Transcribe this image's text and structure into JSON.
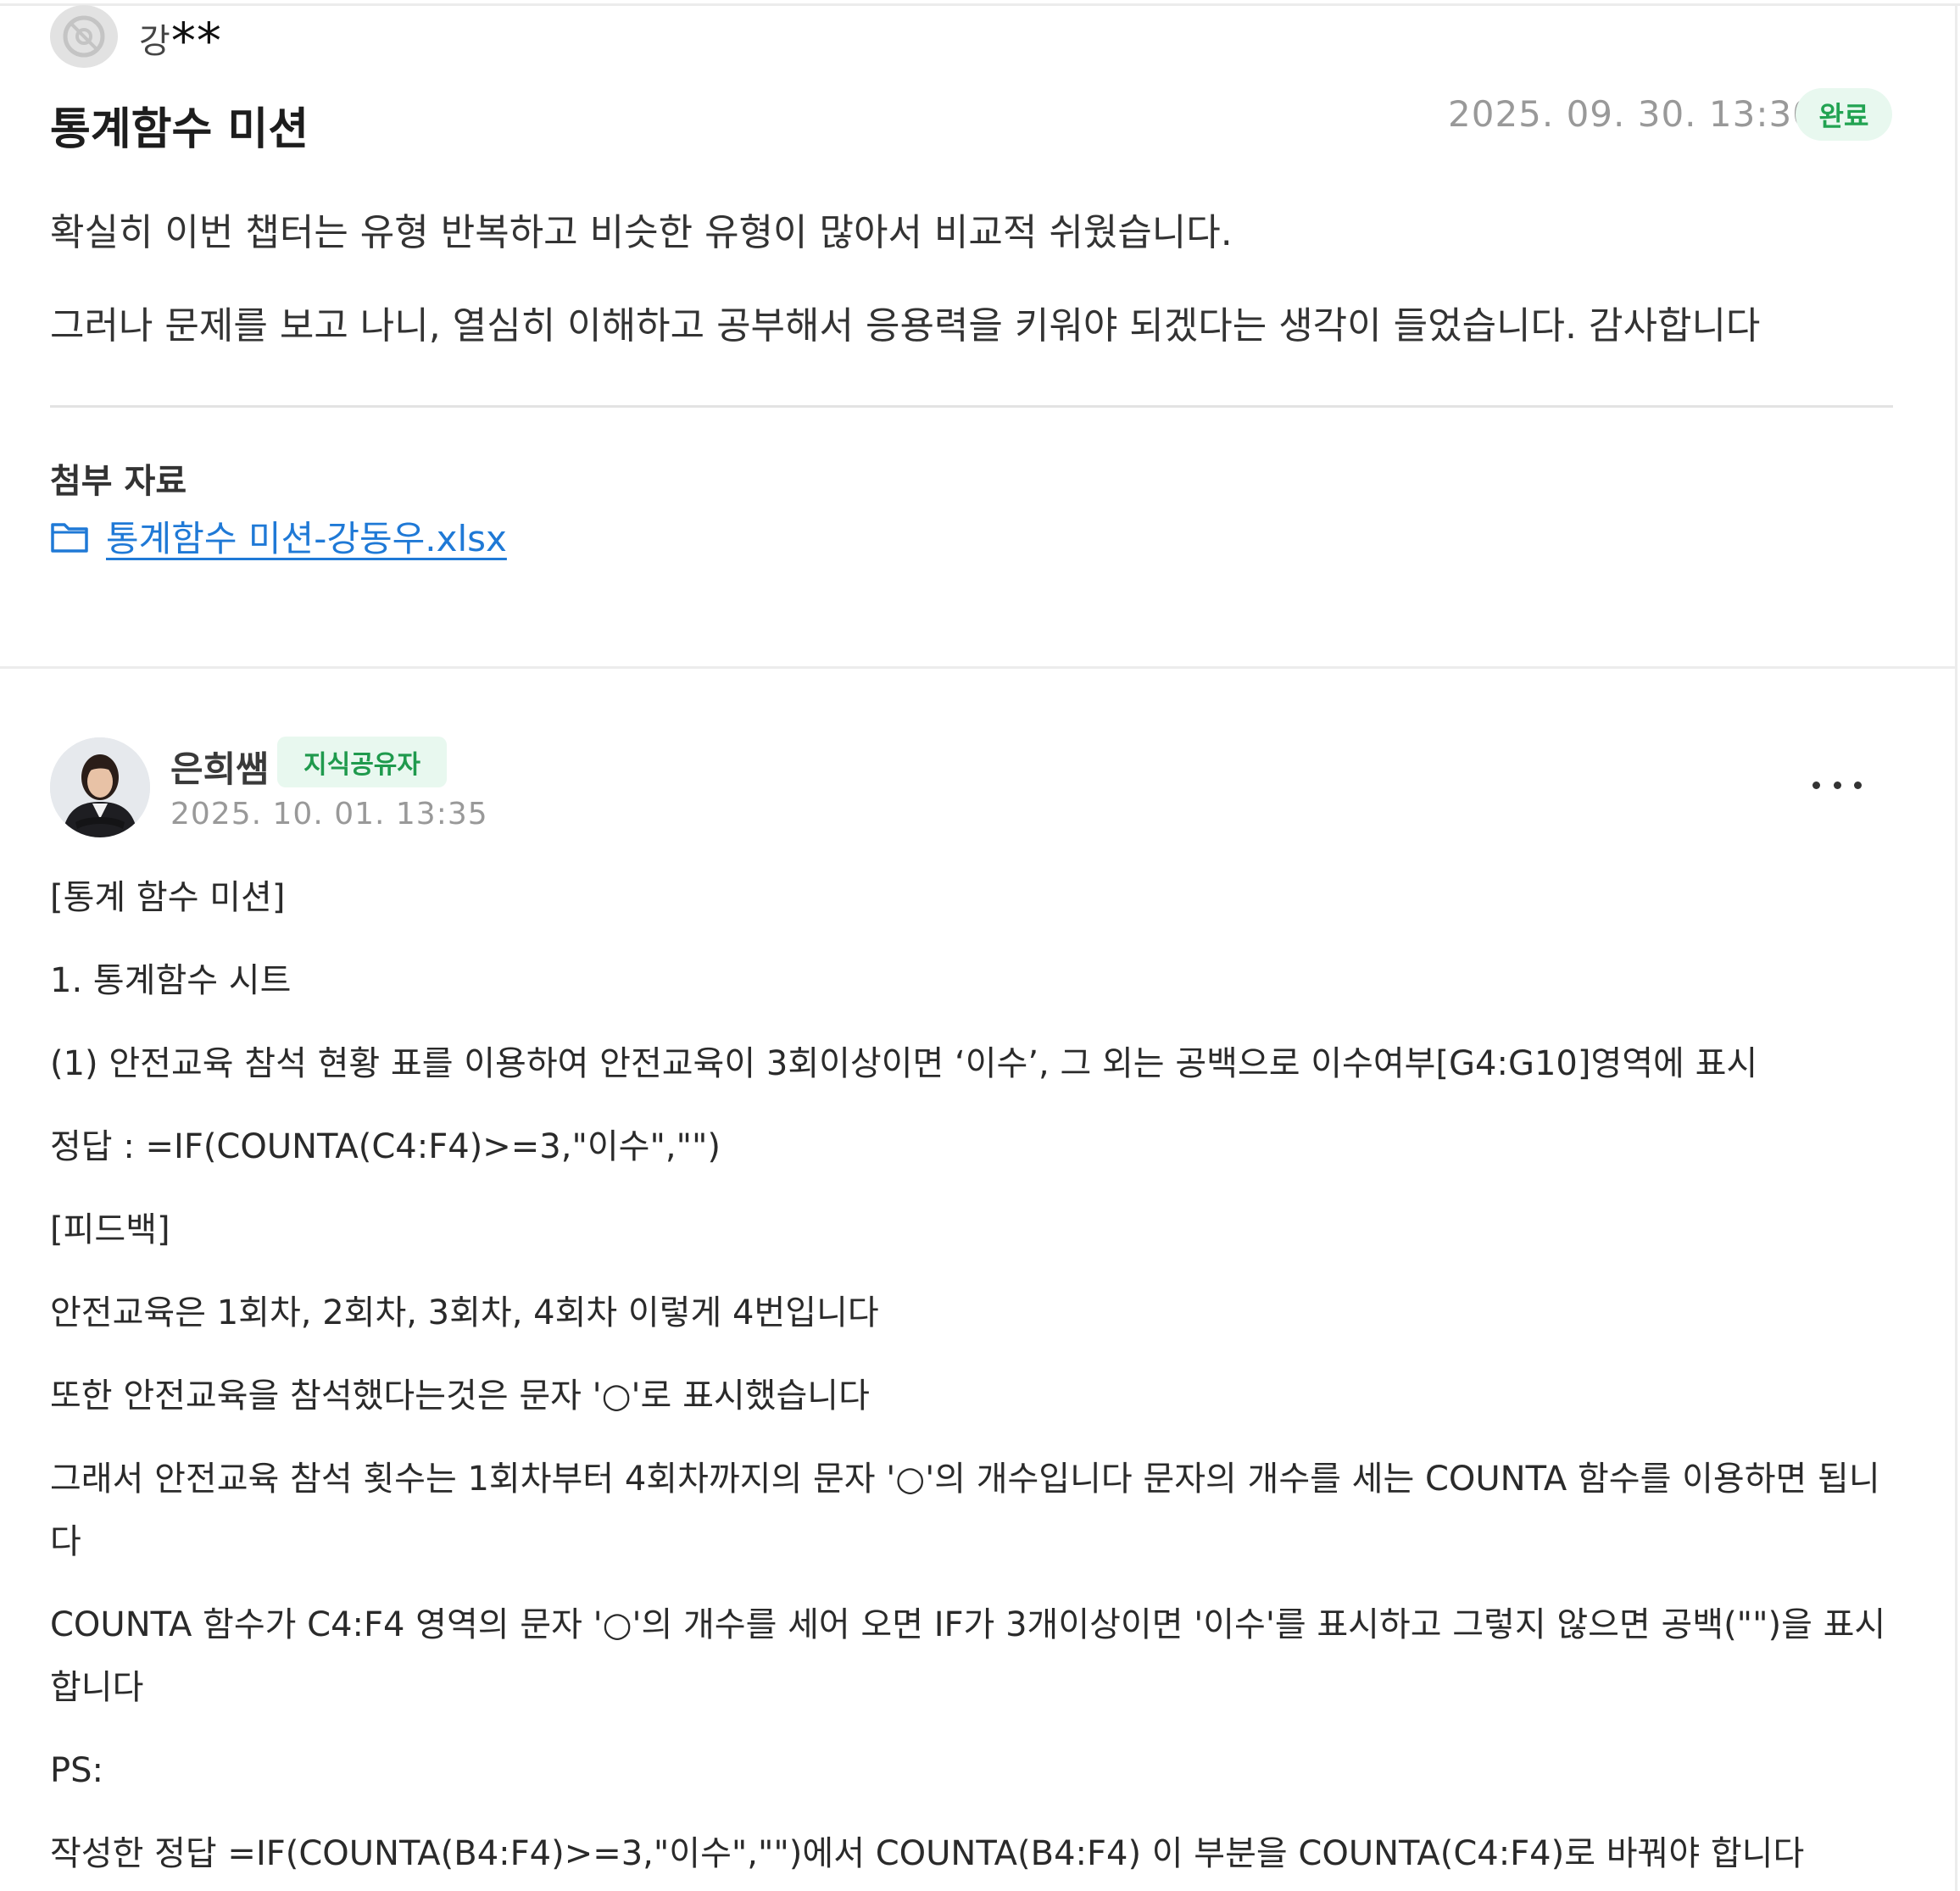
{
  "post": {
    "author": "강",
    "author_masked": "**",
    "title": "통계함수 미션",
    "date": "2025. 09. 30. 13:30",
    "status": "완료",
    "body": [
      "확실히 이번 챕터는 유형 반복하고 비슷한 유형이 많아서 비교적 쉬웠습니다.",
      "그러나 문제를 보고 나니, 열심히 이해하고 공부해서 응용력을 키워야 되겠다는 생각이 들었습니다. 감사합니다"
    ],
    "attachment_label": "첨부 자료",
    "attachment_file": "통계함수 미션-강동우.xlsx",
    "icons": {
      "avatar": "default-avatar-icon",
      "attachment": "folder-icon"
    }
  },
  "comment": {
    "author": "은희쌤",
    "badge": "지식공유자",
    "date": "2025. 10. 01. 13:35",
    "lines": [
      "[통계 함수 미션]",
      "1. 통계함수 시트",
      "(1) 안전교육 참석 현황 표를 이용하여 안전교육이 3회이상이면 ‘이수’, 그 외는 공백으로 이수여부[G4:G10]영역에 표시",
      "정답 : =IF(COUNTA(C4:F4)>=3,\"이수\",\"\")",
      "[피드백]",
      "안전교육은 1회차, 2회차, 3회차, 4회차 이렇게 4번입니다",
      "또한 안전교육을 참석했다는것은 문자 '○'로 표시했습니다",
      "그래서 안전교육 참석 횟수는 1회차부터 4회차까지의 문자 '○'의 개수입니다 문자의 개수를 세는 COUNTA 함수를 이용하면 됩니다",
      "COUNTA 함수가 C4:F4 영역의 문자 '○'의 개수를 세어 오면 IF가 3개이상이면 '이수'를 표시하고 그렇지 않으면 공백(\"\")을 표시합니다",
      "PS:",
      "작성한 정답 =IF(COUNTA(B4:F4)>=3,\"이수\",\"\")에서 COUNTA(B4:F4) 이 부분을 COUNTA(C4:F4)로 바꿔야 합니다"
    ],
    "icons": {
      "more": "more-options-icon"
    }
  },
  "colors": {
    "status_badge_bg": "#e8f8ef",
    "status_badge_text": "#22a352",
    "link": "#1f79d6",
    "meta_text": "#999999"
  }
}
